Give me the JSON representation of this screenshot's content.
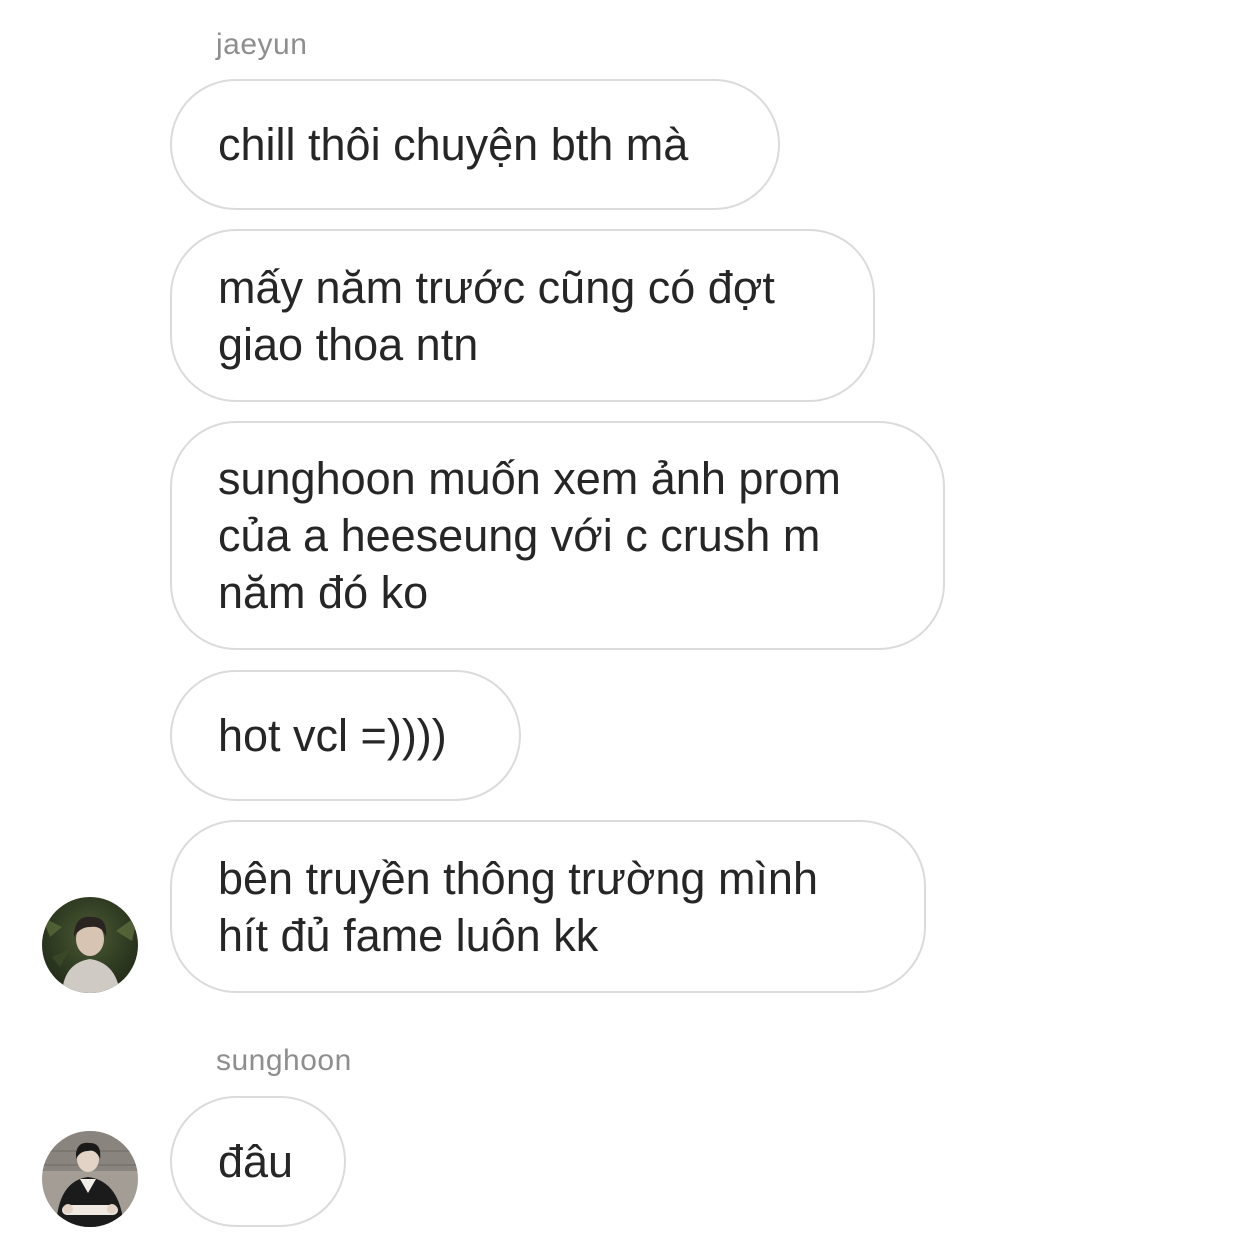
{
  "conversation": {
    "groups": [
      {
        "sender": "jaeyun",
        "messages": [
          "chill thôi chuyện bth mà",
          "mấy năm trước cũng có đợt\ngiao thoa ntn",
          "sunghoon muốn xem ảnh prom\ncủa a heeseung với c crush m\nnăm đó ko",
          "hot vcl =))))",
          "bên truyền thông trường mình\nhít đủ fame luôn kk"
        ]
      },
      {
        "sender": "sunghoon",
        "messages": [
          "đâu"
        ]
      }
    ]
  },
  "colors": {
    "bubble_border": "#dbdbdb",
    "message_text": "#262626",
    "sender_text": "#8e8e8e",
    "background": "#ffffff"
  },
  "icons": {
    "jaeyun_avatar": "avatar-photo",
    "sunghoon_avatar": "avatar-photo"
  }
}
